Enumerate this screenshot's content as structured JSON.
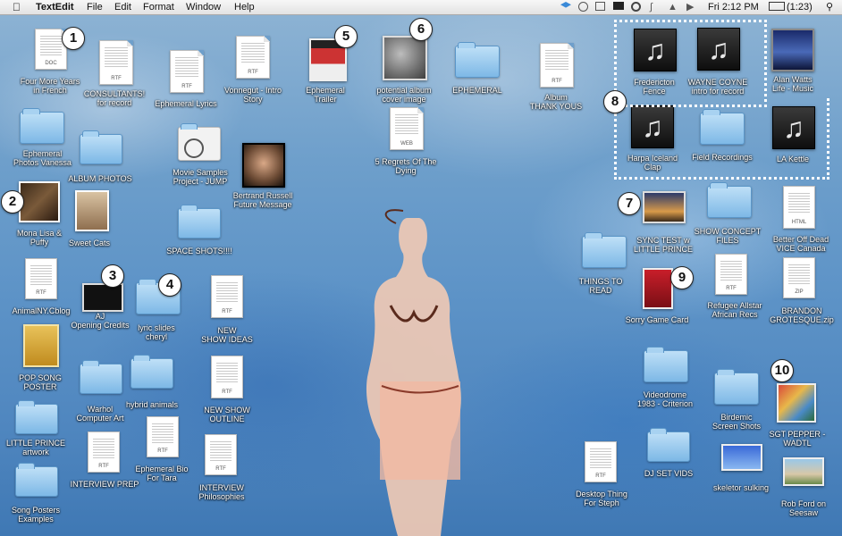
{
  "menubar": {
    "app_name": "TextEdit",
    "menus": [
      "File",
      "Edit",
      "Format",
      "Window",
      "Help"
    ],
    "clock": "Fri 2:12 PM",
    "battery": "(1:23)",
    "icons": [
      "apple-logo",
      "dropbox",
      "recycle",
      "time-machine",
      "display",
      "sync",
      "bluetooth",
      "wifi",
      "volume",
      "battery",
      "spotlight"
    ]
  },
  "callouts": [
    "1",
    "2",
    "3",
    "4",
    "5",
    "6",
    "7",
    "8",
    "9",
    "10"
  ],
  "files": {
    "four_more_years": {
      "label1": "Four More Years",
      "label2": "in French",
      "tag": "DOC"
    },
    "consultants": {
      "label1": "CONSULTANTS!",
      "label2": "for record",
      "tag": "RTF"
    },
    "ephemeral_lyrics": {
      "label1": "Ephemeral Lyrics",
      "tag": "RTF"
    },
    "vonnegut": {
      "label1": "Vonnegut - Intro",
      "label2": "Story",
      "tag": "RTF"
    },
    "ephemeral_trailer": {
      "label1": "Ephemeral",
      "label2": "Trailer"
    },
    "potential_album": {
      "label1": "potential album",
      "label2": "cover image"
    },
    "ephemeral_folder": {
      "label1": "EPHEMERAL"
    },
    "album_thank_yous": {
      "label1": "Album",
      "label2": "THANK YOUS",
      "tag": "RTF"
    },
    "fredericton": {
      "label1": "Fredericton",
      "label2": "Fence"
    },
    "wayne_coyne": {
      "label1": "WAYNE COYNE",
      "label2": "intro for record"
    },
    "alan_watts": {
      "label1": "Alan Watts",
      "label2": "Life - Music"
    },
    "harpa": {
      "label1": "Harpa Iceland",
      "label2": "Clap"
    },
    "field_recordings": {
      "label1": "Field Recordings"
    },
    "la_kettle": {
      "label1": "LA Kettle"
    },
    "ephemeral_photos": {
      "label1": "Ephemeral",
      "label2": "Photos Vanessa"
    },
    "album_photos": {
      "label1": "ALBUM PHOTOS"
    },
    "movie_samples": {
      "label1": "Movie Samples",
      "label2": "Project - JUMP"
    },
    "bertrand": {
      "label1": "Bertrand Russell",
      "label2": "Future Message"
    },
    "five_regrets": {
      "label1": "5 Regrets Of The",
      "label2": "Dying",
      "tag": "WEB"
    },
    "mona_lisa": {
      "label1": "Mona Lisa &",
      "label2": "Puffy"
    },
    "sweet_cats": {
      "label1": "Sweet Cats"
    },
    "space_shots": {
      "label1": "SPACE SHOTS!!!!"
    },
    "sync_test": {
      "label1": "SYNC TEST w",
      "label2": "LITTLE PRINCE"
    },
    "show_concept": {
      "label1": "SHOW CONCEPT",
      "label2": "FILES"
    },
    "better_off_dead": {
      "label1": "Better Off Dead",
      "label2": "VICE Canada",
      "tag": "HTML"
    },
    "animal_ny": {
      "label1": "AnimalNY.Cblog",
      "tag": "RTF"
    },
    "aj_opening": {
      "label1": "AJ",
      "label2": "Opening Credits"
    },
    "lyric_slides": {
      "label1": "lyric slides",
      "label2": "cheryl"
    },
    "new_show_ideas": {
      "label1": "NEW",
      "label2": "SHOW IDEAS",
      "tag": "RTF"
    },
    "things_to_read": {
      "label1": "THINGS TO",
      "label2": "READ"
    },
    "refugee": {
      "label1": "Refugee Allstar",
      "label2": "African Recs",
      "tag": "RTF"
    },
    "brandon": {
      "label1": "BRANDON",
      "label2": "GROTESQUE.zip",
      "tag": "ZIP"
    },
    "sorry_game": {
      "label1": "Sorry Game Card"
    },
    "pop_song": {
      "label1": "POP SONG",
      "label2": "POSTER"
    },
    "warhol": {
      "label1": "Warhol",
      "label2": "Computer Art"
    },
    "hybrid_animals": {
      "label1": "hybrid animals"
    },
    "new_show_outline": {
      "label1": "NEW SHOW",
      "label2": "OUTLINE",
      "tag": "RTF"
    },
    "videodrome": {
      "label1": "Videodrome",
      "label2": "1983 - Criterion"
    },
    "birdemic": {
      "label1": "Birdemic",
      "label2": "Screen Shots"
    },
    "sgt_pepper": {
      "label1": "SGT PEPPER -",
      "label2": "WADTL"
    },
    "little_prince": {
      "label1": "LITTLE PRINCE",
      "label2": "artwork"
    },
    "interview_prep": {
      "label1": "INTERVIEW PREP",
      "tag": "RTF"
    },
    "ephemeral_bio": {
      "label1": "Ephemeral Bio",
      "label2": "For Tara",
      "tag": "RTF"
    },
    "interview_phil": {
      "label1": "INTERVIEW",
      "label2": "Philosophies",
      "tag": "RTF"
    },
    "dj_set": {
      "label1": "DJ SET VIDS"
    },
    "desktop_thing": {
      "label1": "Desktop Thing",
      "label2": "For Steph",
      "tag": "RTF"
    },
    "skeletor": {
      "label1": "skeletor sulking"
    },
    "rob_ford": {
      "label1": "Rob Ford on",
      "label2": "Seesaw"
    },
    "song_posters": {
      "label1": "Song Posters",
      "label2": "Examples"
    }
  }
}
